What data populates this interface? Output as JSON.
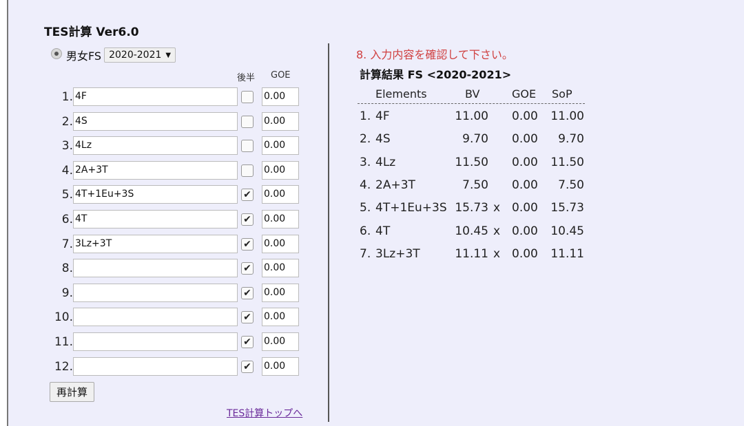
{
  "app": {
    "title": "TES計算 Ver6.0"
  },
  "mode": {
    "label": "男女FS",
    "season_selected": "2020-2021",
    "dropdown_arrow": "▼"
  },
  "input_headers": {
    "second_half": "後半",
    "goe": "GOE"
  },
  "inputs": [
    {
      "num": "1.",
      "element": "4F",
      "second_half": false,
      "goe": "0.00"
    },
    {
      "num": "2.",
      "element": "4S",
      "second_half": false,
      "goe": "0.00"
    },
    {
      "num": "3.",
      "element": "4Lz",
      "second_half": false,
      "goe": "0.00"
    },
    {
      "num": "4.",
      "element": "2A+3T",
      "second_half": false,
      "goe": "0.00"
    },
    {
      "num": "5.",
      "element": "4T+1Eu+3S",
      "second_half": true,
      "goe": "0.00"
    },
    {
      "num": "6.",
      "element": "4T",
      "second_half": true,
      "goe": "0.00"
    },
    {
      "num": "7.",
      "element": "3Lz+3T",
      "second_half": true,
      "goe": "0.00"
    },
    {
      "num": "8.",
      "element": "",
      "second_half": true,
      "goe": "0.00"
    },
    {
      "num": "9.",
      "element": "",
      "second_half": true,
      "goe": "0.00"
    },
    {
      "num": "10.",
      "element": "",
      "second_half": true,
      "goe": "0.00"
    },
    {
      "num": "11.",
      "element": "",
      "second_half": true,
      "goe": "0.00"
    },
    {
      "num": "12.",
      "element": "",
      "second_half": true,
      "goe": "0.00"
    }
  ],
  "buttons": {
    "recalc": "再計算"
  },
  "links": {
    "top": "TES計算トップへ"
  },
  "results": {
    "warning": "8. 入力内容を確認して下さい。",
    "title": "計算結果 FS <2020-2021>",
    "headers": {
      "elements": "Elements",
      "bv": "BV",
      "goe": "GOE",
      "sop": "SoP"
    },
    "rows": [
      {
        "num": "1.",
        "element": "4F",
        "bv": "11.00",
        "x": "",
        "goe": "0.00",
        "sop": "11.00"
      },
      {
        "num": "2.",
        "element": "4S",
        "bv": "9.70",
        "x": "",
        "goe": "0.00",
        "sop": "9.70"
      },
      {
        "num": "3.",
        "element": "4Lz",
        "bv": "11.50",
        "x": "",
        "goe": "0.00",
        "sop": "11.50"
      },
      {
        "num": "4.",
        "element": "2A+3T",
        "bv": "7.50",
        "x": "",
        "goe": "0.00",
        "sop": "7.50"
      },
      {
        "num": "5.",
        "element": "4T+1Eu+3S",
        "bv": "15.73",
        "x": "x",
        "goe": "0.00",
        "sop": "15.73"
      },
      {
        "num": "6.",
        "element": "4T",
        "bv": "10.45",
        "x": "x",
        "goe": "0.00",
        "sop": "10.45"
      },
      {
        "num": "7.",
        "element": "3Lz+3T",
        "bv": "11.11",
        "x": "x",
        "goe": "0.00",
        "sop": "11.11"
      }
    ]
  },
  "colors": {
    "panel_bg": "#eeeefb",
    "warning": "#d04040",
    "link": "#6a2a9a"
  }
}
